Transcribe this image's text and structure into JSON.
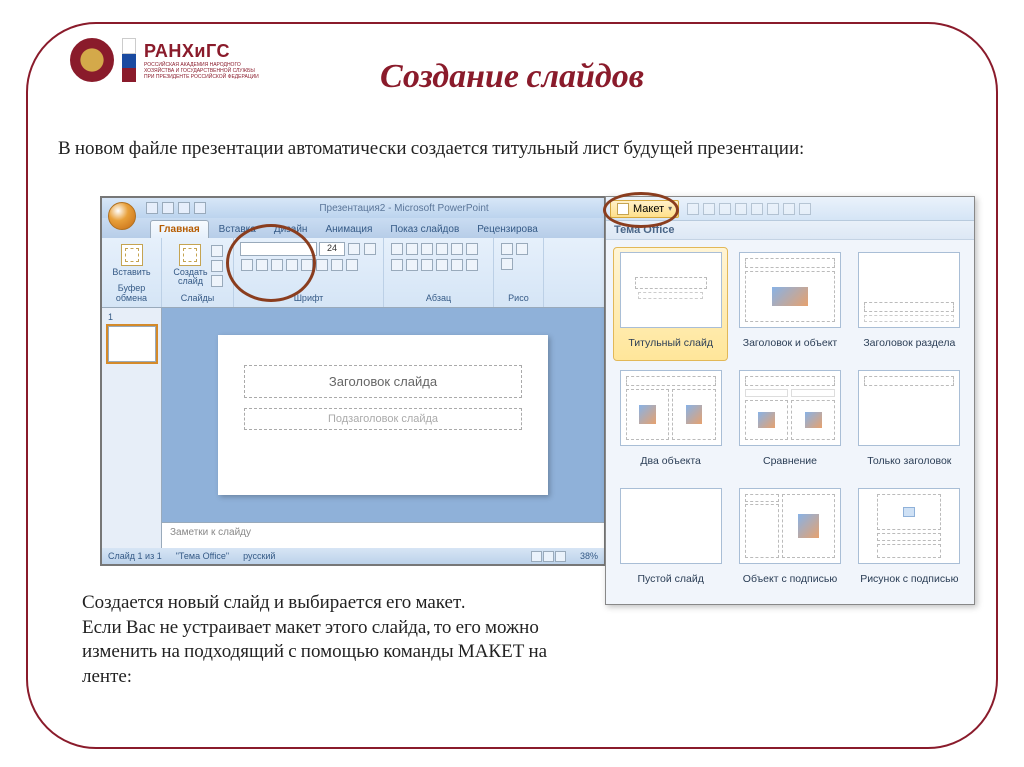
{
  "page": {
    "title": "Создание слайдов",
    "intro": "В новом файле презентации автоматически создается титульный лист будущей презентации:",
    "outro": "Создается новый слайд и выбирается его макет.\nЕсли Вас не устраивает макет этого слайда, то его можно изменить на подходящий с помощью команды МАКЕТ на ленте:"
  },
  "logo": {
    "name": "РАНХиГС",
    "sub": "РОССИЙСКАЯ АКАДЕМИЯ НАРОДНОГО ХОЗЯЙСТВА И ГОСУДАРСТВЕННОЙ СЛУЖБЫ ПРИ ПРЕЗИДЕНТЕ РОССИЙСКОЙ ФЕДЕРАЦИИ"
  },
  "pp": {
    "window_title": "Презентация2 - Microsoft PowerPoint",
    "tabs": [
      "Главная",
      "Вставка",
      "Дизайн",
      "Анимация",
      "Показ слайдов",
      "Рецензирова"
    ],
    "groups": {
      "clipboard": {
        "paste": "Вставить",
        "label": "Буфер обмена"
      },
      "slides": {
        "newslide": "Создать\nслайд",
        "label": "Слайды"
      },
      "font": {
        "label": "Шрифт",
        "size": "24"
      },
      "para": {
        "label": "Абзац"
      },
      "draw": {
        "label": "Рисо"
      }
    },
    "slide": {
      "title_ph": "Заголовок слайда",
      "sub_ph": "Подзаголовок слайда"
    },
    "notes_ph": "Заметки к слайду",
    "status": {
      "slide": "Слайд 1 из 1",
      "theme": "\"Тема Office\"",
      "lang": "русский",
      "zoom": "38%"
    }
  },
  "gallery": {
    "layout_btn": "Макет",
    "header": "Тема Office",
    "items": [
      "Титульный слайд",
      "Заголовок и объект",
      "Заголовок раздела",
      "Два объекта",
      "Сравнение",
      "Только заголовок",
      "Пустой слайд",
      "Объект с подписью",
      "Рисунок с подписью"
    ]
  }
}
